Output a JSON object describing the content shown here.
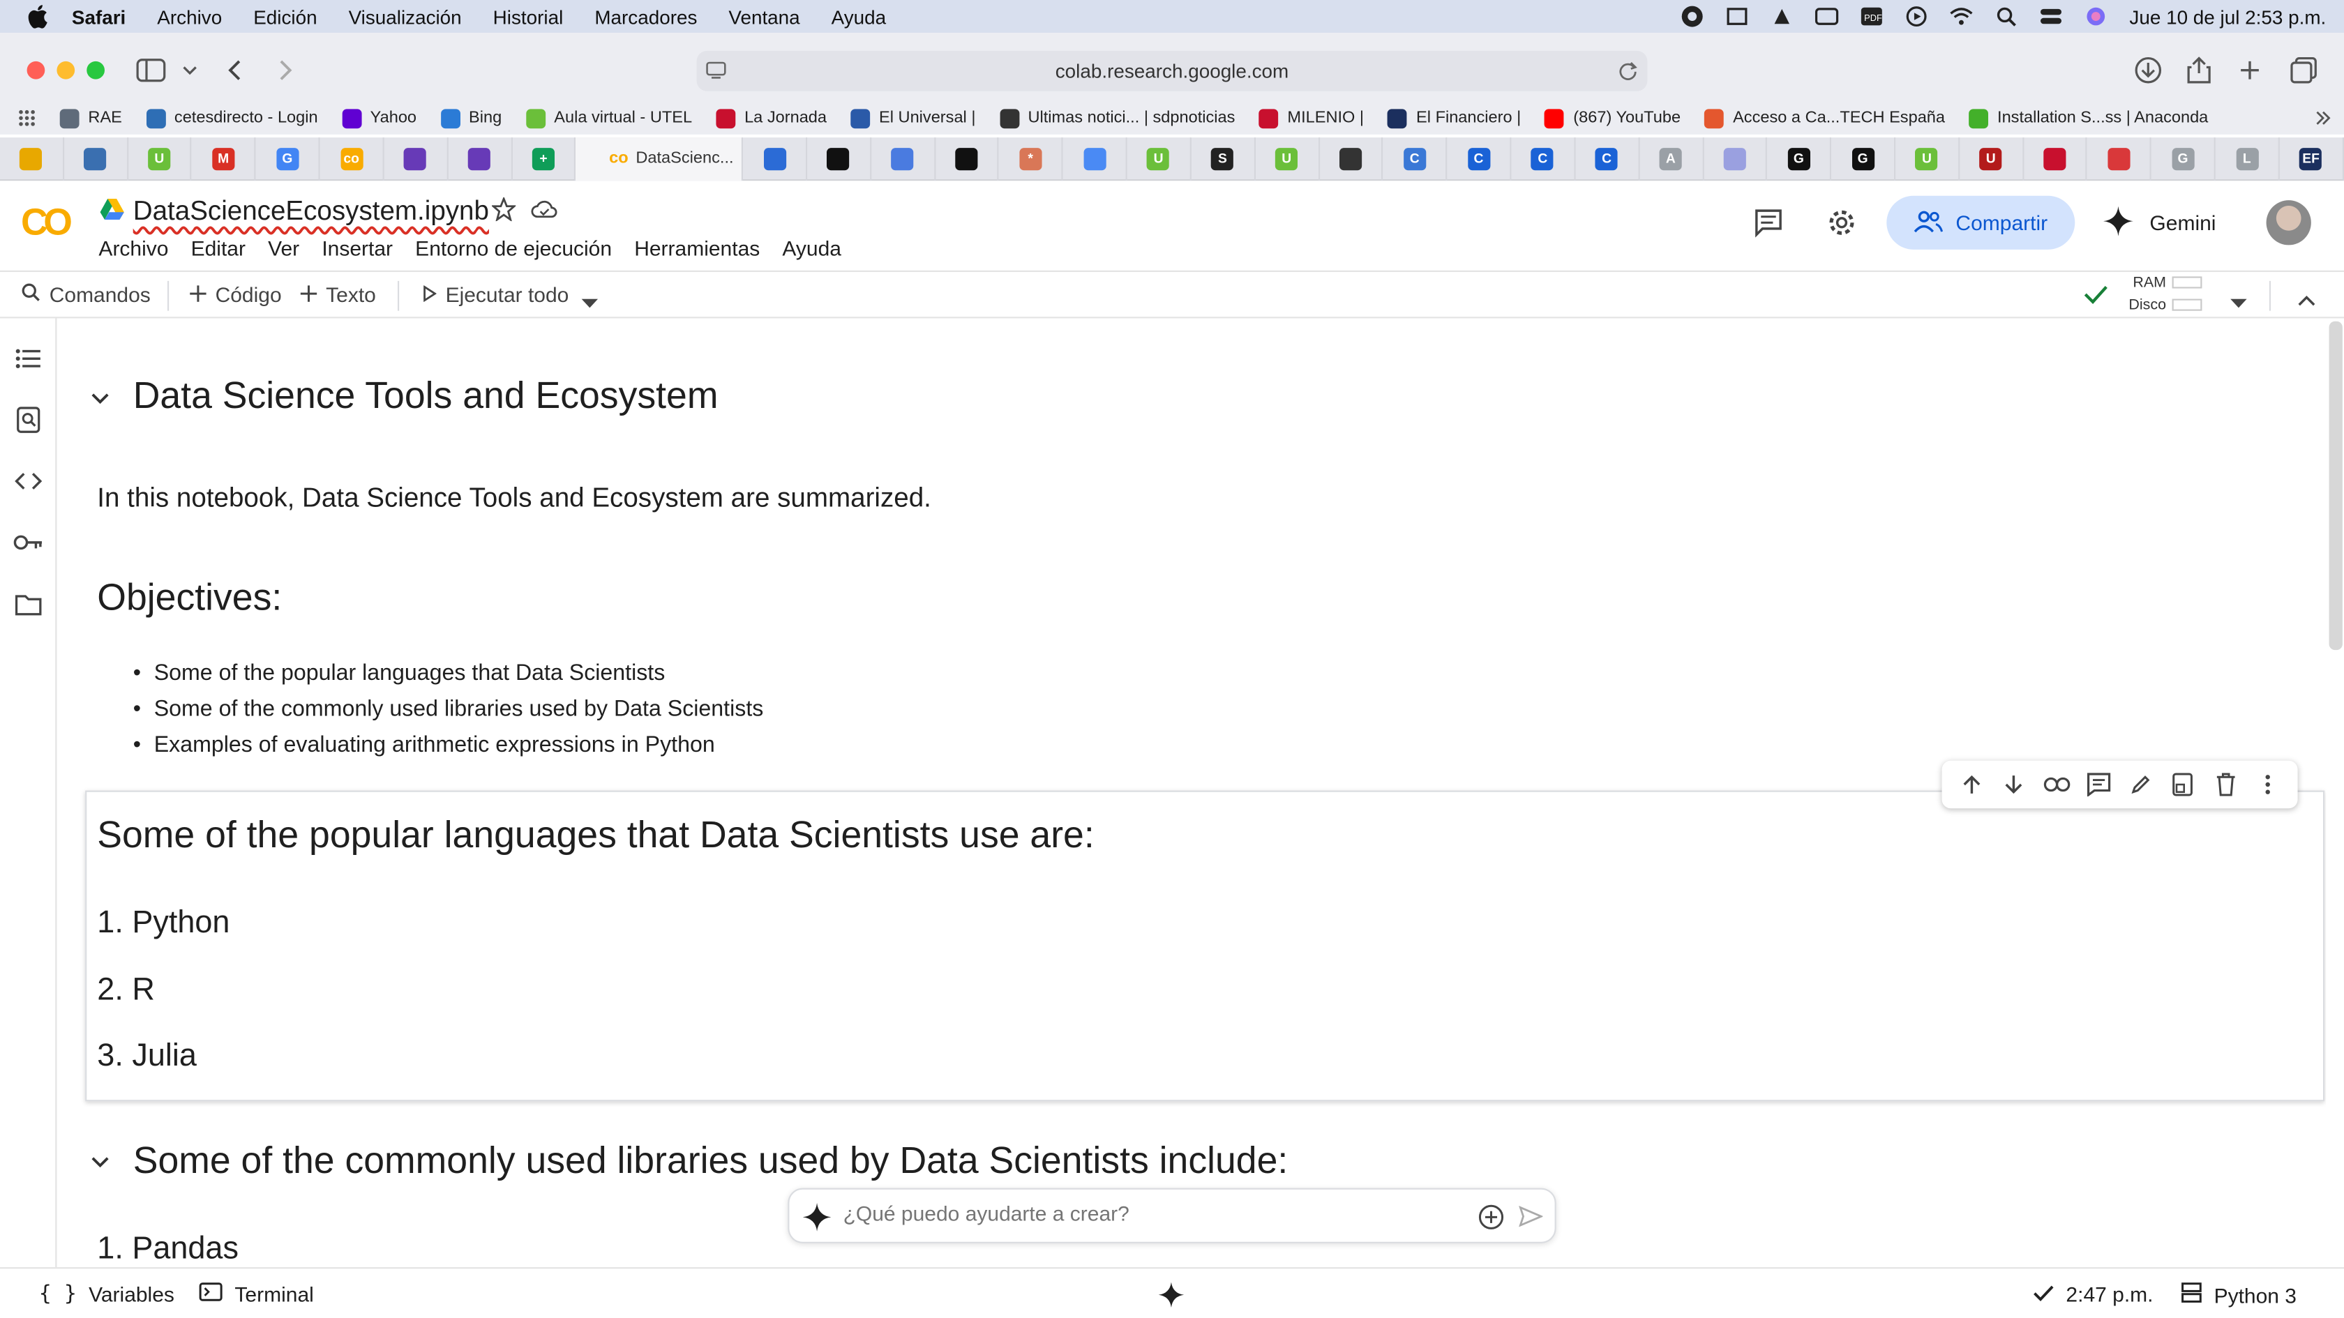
{
  "macos": {
    "app": "Safari",
    "menus": [
      "Archivo",
      "Edición",
      "Visualización",
      "Historial",
      "Marcadores",
      "Ventana",
      "Ayuda"
    ],
    "datetime": "Jue 10 de jul  2:53 p.m."
  },
  "safari": {
    "url": "colab.research.google.com",
    "favorites": [
      {
        "label": "RAE",
        "color": "#5f6b7a"
      },
      {
        "label": "cetesdirecto - Login",
        "color": "#2e6eb5"
      },
      {
        "label": "Yahoo",
        "color": "#6001d2"
      },
      {
        "label": "Bing",
        "color": "#2b7bd6"
      },
      {
        "label": "Aula virtual - UTEL",
        "color": "#6bbf3a"
      },
      {
        "label": "La Jornada",
        "color": "#c8102e"
      },
      {
        "label": "El Universal |",
        "color": "#2b5aa8"
      },
      {
        "label": "Ultimas notici... | sdpnoticias",
        "color": "#333333"
      },
      {
        "label": "MILENIO |",
        "color": "#c8102e"
      },
      {
        "label": "El Financiero |",
        "color": "#1b2f5e"
      },
      {
        "label": "(867) YouTube",
        "color": "#ff0000"
      },
      {
        "label": "Acceso a Ca...TECH España",
        "color": "#e4572e"
      },
      {
        "label": "Installation S...ss | Anaconda",
        "color": "#43b02a"
      }
    ],
    "tabs": [
      {
        "icon": "chart-tab-icon",
        "color": "#e8a800",
        "glyph": ""
      },
      {
        "icon": "globe-tab-icon",
        "color": "#3a6fb0",
        "glyph": ""
      },
      {
        "icon": "utel-tab-icon",
        "color": "#6bbf3a",
        "glyph": "U"
      },
      {
        "icon": "gmail-tab-icon",
        "color": "#d93025",
        "glyph": "M"
      },
      {
        "icon": "google-tab-icon",
        "color": "#4285f4",
        "glyph": "G"
      },
      {
        "icon": "colab-tab-icon",
        "color": "#f9ab00",
        "glyph": "co"
      },
      {
        "icon": "forms-tab-icon",
        "color": "#673ab7",
        "glyph": ""
      },
      {
        "icon": "forms-tab-icon",
        "color": "#673ab7",
        "glyph": ""
      },
      {
        "icon": "sheets-tab-icon",
        "color": "#0f9d58",
        "glyph": "+"
      },
      {
        "icon": "active",
        "label": "DataScienc..."
      },
      {
        "icon": "dropbox-tab-icon",
        "color": "#2b6bd6",
        "glyph": ""
      },
      {
        "icon": "github-tab-icon",
        "color": "#111111",
        "glyph": ""
      },
      {
        "icon": "bird-tab-icon",
        "color": "#4a7be0",
        "glyph": ""
      },
      {
        "icon": "openai-tab-icon",
        "color": "#111111",
        "glyph": ""
      },
      {
        "icon": "claude-tab-icon",
        "color": "#d97757",
        "glyph": "*"
      },
      {
        "icon": "gemini-tab-icon",
        "color": "#4a8af4",
        "glyph": ""
      },
      {
        "icon": "utel-tab-icon",
        "color": "#6bbf3a",
        "glyph": "U"
      },
      {
        "icon": "s-tab-icon",
        "color": "#222222",
        "glyph": "S"
      },
      {
        "icon": "utel-tab-icon",
        "color": "#6bbf3a",
        "glyph": "U"
      },
      {
        "icon": "wifi-tab-icon",
        "color": "#333333",
        "glyph": ""
      },
      {
        "icon": "circle-tab-icon",
        "color": "#3a78d6",
        "glyph": "C"
      },
      {
        "icon": "c-tab-icon",
        "color": "#1a62d6",
        "glyph": "C"
      },
      {
        "icon": "c-tab-icon",
        "color": "#1a62d6",
        "glyph": "C"
      },
      {
        "icon": "c-tab-icon",
        "color": "#1a62d6",
        "glyph": "C"
      },
      {
        "icon": "a-tab-icon",
        "color": "#9aa0a6",
        "glyph": "A"
      },
      {
        "icon": "loader-tab-icon",
        "color": "#9aa0e0",
        "glyph": ""
      },
      {
        "icon": "g-tab-icon",
        "color": "#111111",
        "glyph": "G"
      },
      {
        "icon": "g-tab-icon",
        "color": "#111111",
        "glyph": "G"
      },
      {
        "icon": "utel-tab-icon",
        "color": "#6bbf3a",
        "glyph": "U"
      },
      {
        "icon": "u-red-tab-icon",
        "color": "#b31b1b",
        "glyph": "U"
      },
      {
        "icon": "crown-tab-icon",
        "color": "#c8102e",
        "glyph": ""
      },
      {
        "icon": "mail-red-tab-icon",
        "color": "#d9383a",
        "glyph": ""
      },
      {
        "icon": "g-grey-tab-icon",
        "color": "#9aa0a6",
        "glyph": "G"
      },
      {
        "icon": "l-tab-icon",
        "color": "#9aa0a6",
        "glyph": "L"
      },
      {
        "icon": "ef-tab-icon",
        "color": "#1b2f5e",
        "glyph": "EF"
      }
    ]
  },
  "colab": {
    "filename": "DataScienceEcosystem.ipynb",
    "menus": [
      "Archivo",
      "Editar",
      "Ver",
      "Insertar",
      "Entorno de ejecución",
      "Herramientas",
      "Ayuda"
    ],
    "share_label": "Compartir",
    "gemini_label": "Gemini",
    "toolbar": {
      "commands": "Comandos",
      "code": "Código",
      "text": "Texto",
      "run_all": "Ejecutar todo",
      "ram": "RAM",
      "disk": "Disco"
    },
    "cells": {
      "title": "Data Science Tools and Ecosystem",
      "intro": "In this notebook, Data Science Tools and Ecosystem are summarized.",
      "objectives_heading": "Objectives:",
      "objectives": [
        "Some of the popular languages that Data Scientists",
        "Some of the commonly used libraries used by Data Scientists",
        "Examples of evaluating arithmetic expressions in Python"
      ],
      "languages_heading": "Some of the popular languages that Data Scientists use are:",
      "languages": [
        "1. Python",
        "2. R",
        "3. Julia"
      ],
      "libraries_heading": "Some of the commonly used libraries used by Data Scientists include:",
      "libraries": [
        "1. Pandas"
      ]
    },
    "gemini_input_placeholder": "¿Qué puedo ayudarte a crear?",
    "status": {
      "variables": "Variables",
      "terminal": "Terminal",
      "time": "2:47 p.m.",
      "runtime": "Python 3"
    },
    "colors": {
      "accent": "#0b57d0",
      "share_bg": "#d3e3fd",
      "logo": "#f9ab00",
      "check": "#188038"
    }
  }
}
